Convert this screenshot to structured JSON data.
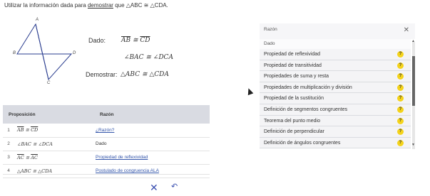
{
  "instruction": {
    "text_before": "Utilizar la información dada para ",
    "link": "demostrar",
    "text_after": " que △ABC ≅ △CDA."
  },
  "figure": {
    "labels": {
      "A": "A",
      "B": "B",
      "C": "C",
      "D": "D"
    }
  },
  "given": {
    "label": "Dado:",
    "seg1": "AB",
    "rel": " ≅ ",
    "seg2": "CD",
    "angle_stmt": "∠BAC ≅ ∠DCA"
  },
  "prove": {
    "label": "Demostrar:",
    "stmt": "△ABC ≅ △CDA"
  },
  "table": {
    "col_statement": "Proposición",
    "col_reason": "Razón",
    "rows": [
      {
        "num": "1",
        "statement_a": "AB",
        "statement_rel": " ≅ ",
        "statement_b": "CD",
        "reason": "¿Razón?"
      },
      {
        "num": "2",
        "statement": "∠BAC ≅ ∠DCA",
        "reason": "Dado"
      },
      {
        "num": "3",
        "statement_a": "AC",
        "statement_rel": " ≅ ",
        "statement_b": "AC",
        "reason": "Propiedad de reflexividad"
      },
      {
        "num": "4",
        "statement": "△ABC ≅ △CDA",
        "reason": "Postulado de congruencia ALA"
      }
    ]
  },
  "toolbar": {
    "close_icon": "close-icon",
    "undo_icon": "undo-icon"
  },
  "panel": {
    "title": "Razón",
    "dado": "Dado",
    "help_icon_color": "#f4d31a",
    "items": [
      "Propiedad de reflexividad",
      "Propiedad de transitividad",
      "Propiedades de suma y resta",
      "Propiedades de multiplicación y división",
      "Propiedad de la sustitución",
      "Definición de segmentos congruentes",
      "Teorema del punto medio",
      "Definición de perpendicular",
      "Definición de ángulos congruentes"
    ]
  }
}
